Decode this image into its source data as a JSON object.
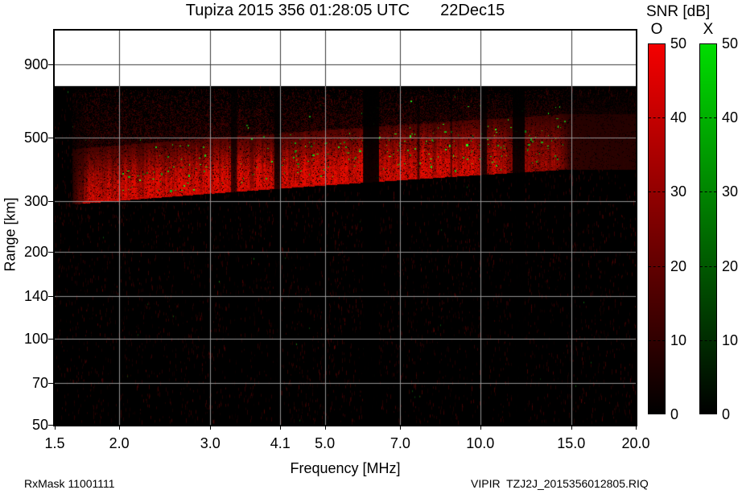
{
  "header": {
    "title": "Tupiza 2015 356 01:28:05 UTC",
    "date": "22Dec15"
  },
  "footer": {
    "left": "RxMask 11001111",
    "right": "VIPIR  TZJ2J_2015356012805.RIQ"
  },
  "colorbars": {
    "title": "SNR [dB]",
    "min": 0,
    "max": 50,
    "tick_values": [
      0,
      10,
      20,
      30,
      40,
      50
    ],
    "dashed_tick_values": [
      10,
      20,
      30,
      40
    ],
    "bars": [
      {
        "label": "O",
        "color_top": "#f40000"
      },
      {
        "label": "X",
        "color_top": "#00dd00"
      }
    ]
  },
  "chart_data": {
    "type": "heatmap",
    "title": "Tupiza 2015 356 01:28:05 UTC 22Dec15",
    "xlabel": "Frequency [MHz]",
    "ylabel": "Range [km]",
    "x_scale": "log",
    "y_scale": "log",
    "xlim": [
      1.5,
      20.0
    ],
    "ylim": [
      50,
      1180
    ],
    "x_ticks": [
      1.5,
      2.0,
      3.0,
      4.1,
      5.0,
      7.0,
      10.0,
      15.0,
      20.0
    ],
    "x_tick_labels": [
      "1.5",
      "2.0",
      "3.0",
      "4.1",
      "5.0",
      "7.0",
      "10.0",
      "15.0",
      "20.0"
    ],
    "y_ticks": [
      900,
      500,
      300,
      200,
      140,
      100,
      70,
      50
    ],
    "y_tick_labels": [
      "900",
      "500",
      "300",
      "200",
      "140",
      "100",
      "70",
      "50"
    ],
    "grid_x": [
      2.0,
      3.0,
      4.1,
      5.0,
      7.0,
      10.0,
      15.0
    ],
    "grid_y": [
      900,
      500,
      300,
      200,
      140,
      100,
      70
    ],
    "legend": {
      "O_mode_color": "red",
      "X_mode_color": "green",
      "units": "SNR dB 0-50"
    },
    "data_ceiling_km": 755,
    "seed": 2015356,
    "echo": {
      "description": "diffuse spread-F O-mode echo band with X-mode speckles",
      "f_min_mhz": 1.65,
      "f_max_mhz": 14.9,
      "bottom_km_at_fmin": 295,
      "bottom_km_at_fmax": 390,
      "strong_top_factor": 1.55,
      "diffuse_top_km": 740,
      "bright_rim_max_mhz": 9.6,
      "gain_points": [
        [
          1.62,
          0
        ],
        [
          1.75,
          0.85
        ],
        [
          2.2,
          1.0
        ],
        [
          9.5,
          1.0
        ],
        [
          10.5,
          0.8
        ],
        [
          12.8,
          0.65
        ],
        [
          14.0,
          0.55
        ],
        [
          14.6,
          0.3
        ],
        [
          15.0,
          0.07
        ],
        [
          18.0,
          0.05
        ],
        [
          20.0,
          0.04
        ]
      ]
    },
    "rfi_gaps_mhz": [
      [
        3.29,
        3.38,
        0.7
      ],
      [
        3.99,
        4.12,
        0.8
      ],
      [
        5.93,
        6.37,
        0.92
      ],
      [
        7.55,
        7.63,
        0.55
      ],
      [
        8.75,
        8.83,
        0.55
      ],
      [
        10.05,
        10.3,
        0.8
      ],
      [
        11.55,
        12.2,
        0.9
      ]
    ],
    "x_mode_dots": {
      "count": 300,
      "f_range_mhz": [
        2.0,
        14.6
      ],
      "low_freq_thin_below_mhz": 4.3
    },
    "noise": {
      "red_dash_density_per_col": 9,
      "green_dot_prob_per_col": 0.05
    }
  }
}
